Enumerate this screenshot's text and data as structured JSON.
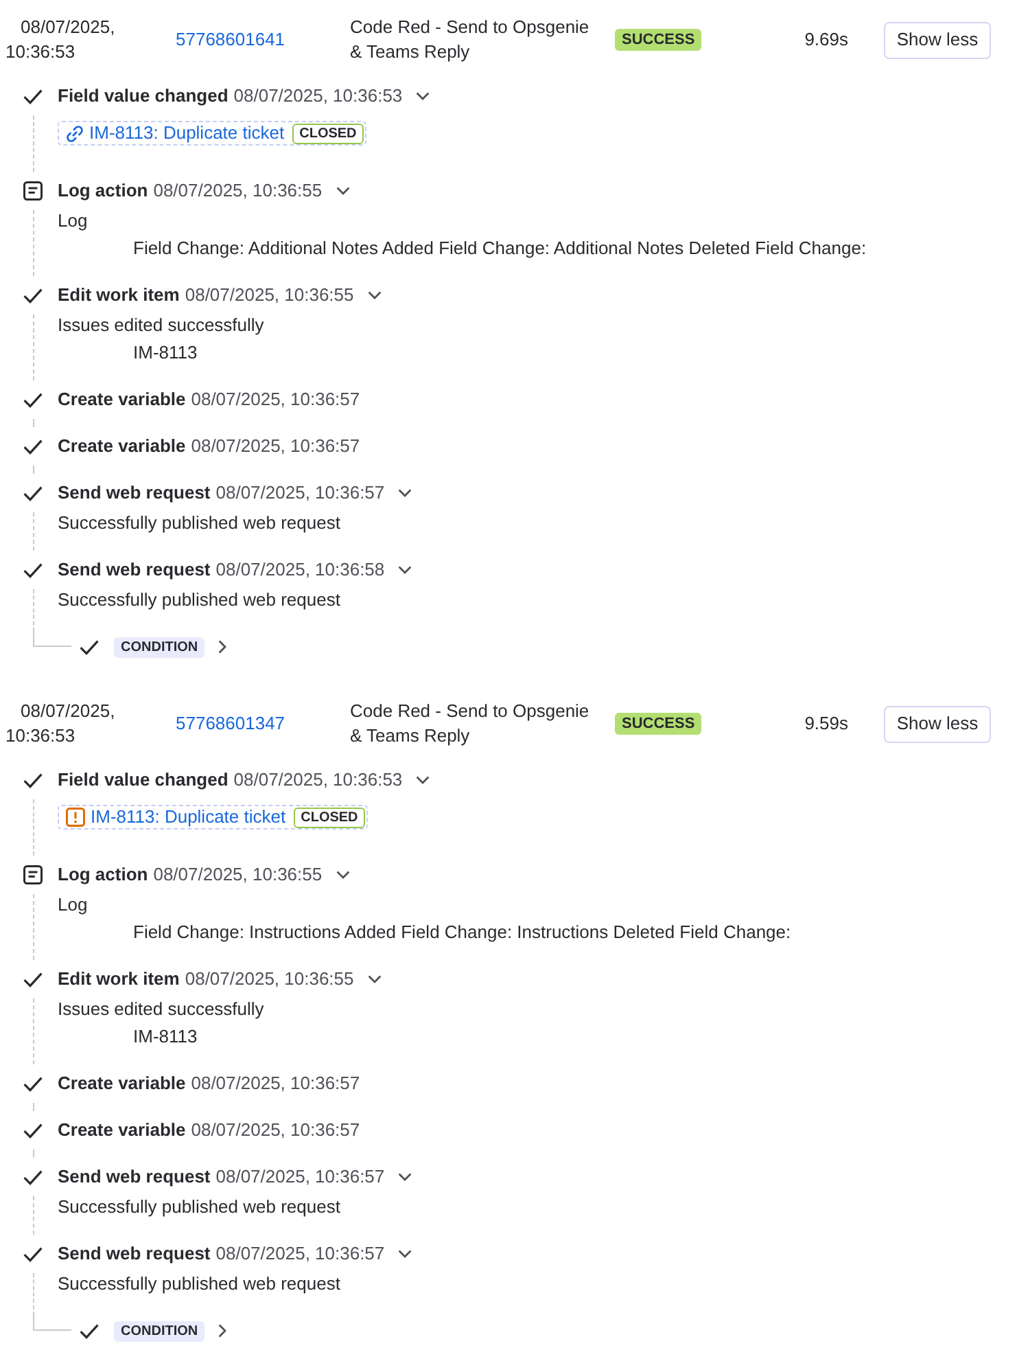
{
  "runs": [
    {
      "date": "08/07/2025, 10:36:53",
      "id": "57768601641",
      "rule": "Code Red - Send to Opsgenie & Teams Reply",
      "status": {
        "label": "SUCCESS",
        "kind": "success"
      },
      "duration": "9.69s",
      "toggle": "Show less",
      "steps": [
        {
          "kind": "check",
          "title": "Field value changed",
          "time": "08/07/2025, 10:36:53",
          "expandable": true,
          "ticket": {
            "kind": "link",
            "label": "IM-8113: Duplicate ticket",
            "status": "CLOSED"
          }
        },
        {
          "kind": "log",
          "title": "Log action",
          "time": "08/07/2025, 10:36:55",
          "expandable": true,
          "details": [
            {
              "text": "Log",
              "indented": false
            },
            {
              "text": "Field Change: Additional Notes Added Field Change: Additional Notes Deleted Field Change:",
              "indented": true
            }
          ]
        },
        {
          "kind": "check",
          "title": "Edit work item",
          "time": "08/07/2025, 10:36:55",
          "expandable": true,
          "details": [
            {
              "text": "Issues edited successfully",
              "indented": false
            },
            {
              "text": "IM-8113",
              "indented": true
            }
          ]
        },
        {
          "kind": "check",
          "title": "Create variable",
          "time": "08/07/2025, 10:36:57",
          "expandable": false
        },
        {
          "kind": "check",
          "title": "Create variable",
          "time": "08/07/2025, 10:36:57",
          "expandable": false
        },
        {
          "kind": "check",
          "title": "Send web request",
          "time": "08/07/2025, 10:36:57",
          "expandable": true,
          "details": [
            {
              "text": "Successfully published web request",
              "indented": false
            }
          ]
        },
        {
          "kind": "check",
          "title": "Send web request",
          "time": "08/07/2025, 10:36:58",
          "expandable": true,
          "details": [
            {
              "text": "Successfully published web request",
              "indented": false
            }
          ]
        }
      ],
      "condition": {
        "label": "CONDITION",
        "expanded": false
      }
    },
    {
      "date": "08/07/2025, 10:36:53",
      "id": "57768601347",
      "rule": "Code Red - Send to Opsgenie & Teams Reply",
      "status": {
        "label": "SUCCESS",
        "kind": "success"
      },
      "duration": "9.59s",
      "toggle": "Show less",
      "steps": [
        {
          "kind": "check",
          "title": "Field value changed",
          "time": "08/07/2025, 10:36:53",
          "expandable": true,
          "ticket": {
            "kind": "alert",
            "label": "IM-8113: Duplicate ticket",
            "status": "CLOSED"
          }
        },
        {
          "kind": "log",
          "title": "Log action",
          "time": "08/07/2025, 10:36:55",
          "expandable": true,
          "details": [
            {
              "text": "Log",
              "indented": false
            },
            {
              "text": "Field Change: Instructions Added Field Change: Instructions Deleted Field Change:",
              "indented": true
            }
          ]
        },
        {
          "kind": "check",
          "title": "Edit work item",
          "time": "08/07/2025, 10:36:55",
          "expandable": true,
          "details": [
            {
              "text": "Issues edited successfully",
              "indented": false
            },
            {
              "text": "IM-8113",
              "indented": true
            }
          ]
        },
        {
          "kind": "check",
          "title": "Create variable",
          "time": "08/07/2025, 10:36:57",
          "expandable": false
        },
        {
          "kind": "check",
          "title": "Create variable",
          "time": "08/07/2025, 10:36:57",
          "expandable": false
        },
        {
          "kind": "check",
          "title": "Send web request",
          "time": "08/07/2025, 10:36:57",
          "expandable": true,
          "details": [
            {
              "text": "Successfully published web request",
              "indented": false
            }
          ]
        },
        {
          "kind": "check",
          "title": "Send web request",
          "time": "08/07/2025, 10:36:57",
          "expandable": true,
          "details": [
            {
              "text": "Successfully published web request",
              "indented": false
            }
          ]
        }
      ],
      "condition": {
        "label": "CONDITION",
        "expanded": false
      }
    }
  ]
}
